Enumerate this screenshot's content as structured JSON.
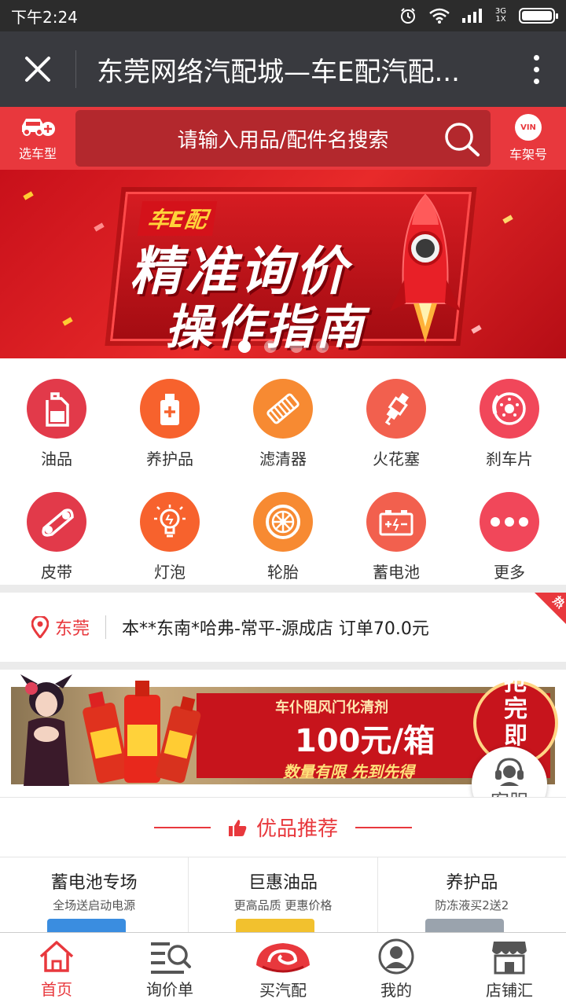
{
  "status_bar": {
    "time": "下午2:24",
    "network_top": "3G",
    "network_bottom": "1X"
  },
  "header": {
    "title": "东莞网络汽配城—车E配汽配..."
  },
  "search": {
    "left_label": "选车型",
    "placeholder": "请输入用品/配件名搜索",
    "right_badge": "VIN",
    "right_label": "车架号"
  },
  "banner": {
    "brand": "车E配",
    "line1": "精准询价",
    "line2": "操作指南",
    "slide_count": 4,
    "active_slide": 1
  },
  "categories": [
    {
      "label": "油品",
      "icon": "oil-icon",
      "color": "#e23a4a"
    },
    {
      "label": "养护品",
      "icon": "maintenance-icon",
      "color": "#f7622d"
    },
    {
      "label": "滤清器",
      "icon": "filter-icon",
      "color": "#f78a32"
    },
    {
      "label": "火花塞",
      "icon": "spark-plug-icon",
      "color": "#f2604e"
    },
    {
      "label": "刹车片",
      "icon": "brake-icon",
      "color": "#f1475a"
    },
    {
      "label": "皮带",
      "icon": "belt-icon",
      "color": "#e23a4a"
    },
    {
      "label": "灯泡",
      "icon": "bulb-icon",
      "color": "#f7622d"
    },
    {
      "label": "轮胎",
      "icon": "tire-icon",
      "color": "#f78a32"
    },
    {
      "label": "蓄电池",
      "icon": "battery-icon",
      "color": "#f2604e"
    },
    {
      "label": "更多",
      "icon": "more-icon",
      "color": "#f1475a"
    }
  ],
  "ticker": {
    "location": "东莞",
    "message": "本**东南*哈弗-常平-源成店 订单70.0元",
    "hot": "热"
  },
  "promo": {
    "title": "车仆阻风门化清剂",
    "price": "100元/箱",
    "tagline": "数量有限 先到先得",
    "badge": "抢完即止"
  },
  "service": {
    "label": "客服"
  },
  "recommend": {
    "title": "优品推荐"
  },
  "features": [
    {
      "title": "蓄电池专场",
      "subtitle": "全场送启动电源",
      "peek_color": "#3a8de0"
    },
    {
      "title": "巨惠油品",
      "subtitle": "更高品质 更惠价格",
      "peek_color": "#f2c12e"
    },
    {
      "title": "养护品",
      "subtitle": "防冻液买2送2",
      "peek_color": "#9aa3ad"
    }
  ],
  "bottom_nav": [
    {
      "label": "首页",
      "icon": "home-icon",
      "active": true
    },
    {
      "label": "询价单",
      "icon": "inquiry-list-icon",
      "active": false
    },
    {
      "label": "买汽配",
      "icon": "buy-parts-icon",
      "active": false
    },
    {
      "label": "我的",
      "icon": "profile-icon",
      "active": false
    },
    {
      "label": "店铺汇",
      "icon": "store-icon",
      "active": false
    }
  ],
  "colors": {
    "accent": "#e8383d",
    "header_bg": "#393a3f",
    "status_bg": "#2c2c2c"
  }
}
